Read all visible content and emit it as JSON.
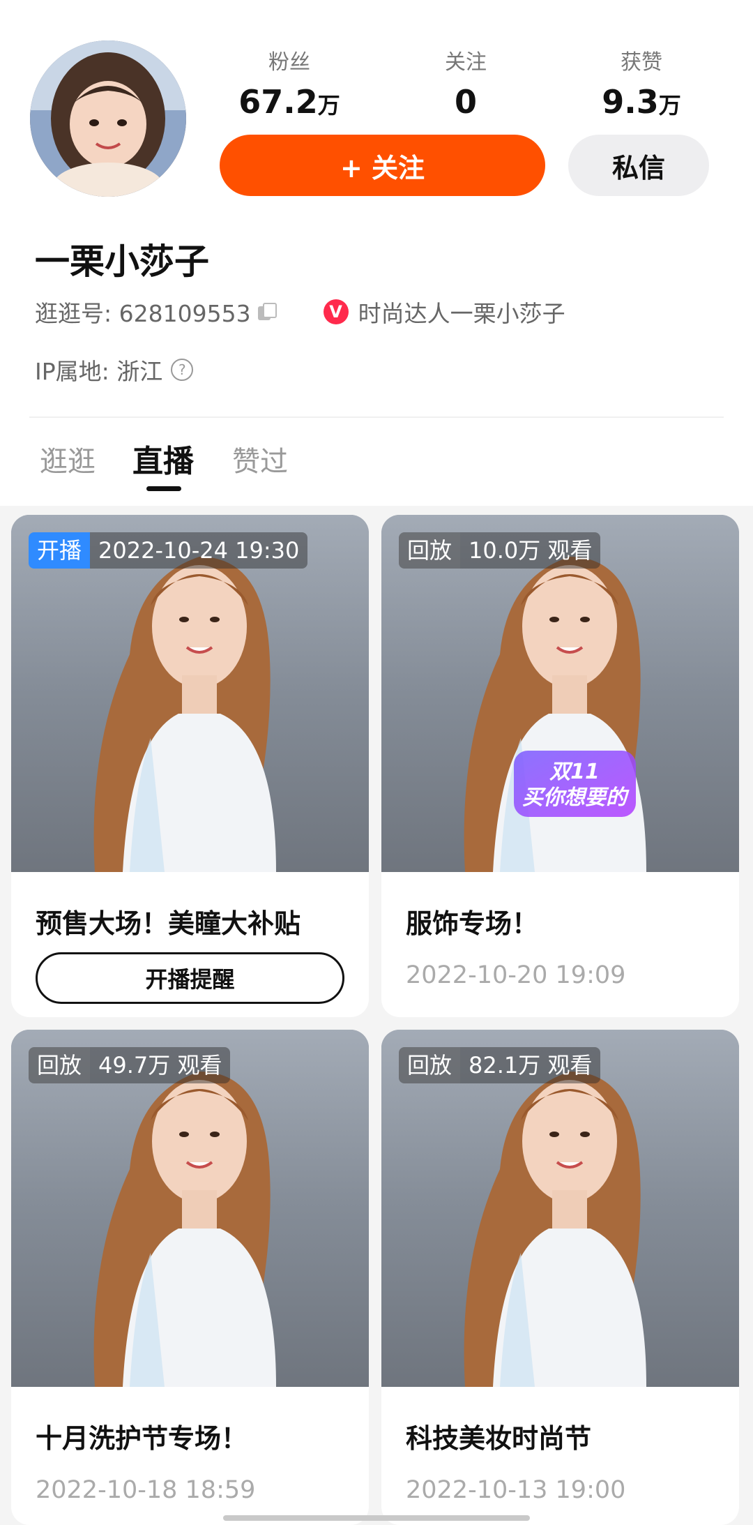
{
  "profile": {
    "username": "一栗小莎子",
    "id_label": "逛逛号: 628109553",
    "verified_label": "时尚达人一栗小莎子",
    "ip_label": "IP属地: 浙江"
  },
  "stats": [
    {
      "label": "粉丝",
      "value": "67.2",
      "unit": "万"
    },
    {
      "label": "关注",
      "value": "0",
      "unit": ""
    },
    {
      "label": "获赞",
      "value": "9.3",
      "unit": "万"
    }
  ],
  "actions": {
    "follow": "+ 关注",
    "message": "私信"
  },
  "tabs": [
    "逛逛",
    "直播",
    "赞过"
  ],
  "active_tab": "直播",
  "cards": [
    {
      "tag": "开播",
      "tag_type": "live",
      "info": "2022-10-24 19:30",
      "title": "预售大场！美瞳大补贴",
      "button": "开播提醒"
    },
    {
      "tag": "回放",
      "tag_type": "replay",
      "info": "10.0万 观看",
      "title": "服饰专场！",
      "date": "2022-10-20 19:09",
      "sticker": {
        "line1": "双11",
        "line2": "买你想要的"
      }
    },
    {
      "tag": "回放",
      "tag_type": "replay",
      "info": "49.7万 观看",
      "title": "十月洗护节专场！",
      "date": "2022-10-18 18:59"
    },
    {
      "tag": "回放",
      "tag_type": "replay",
      "info": "82.1万 观看",
      "title": "科技美妆时尚节",
      "date": "2022-10-13 19:00"
    }
  ],
  "colors": {
    "accent": "#ff5000",
    "live_blue": "#2f8bff",
    "verify_red": "#ff2a4c"
  }
}
